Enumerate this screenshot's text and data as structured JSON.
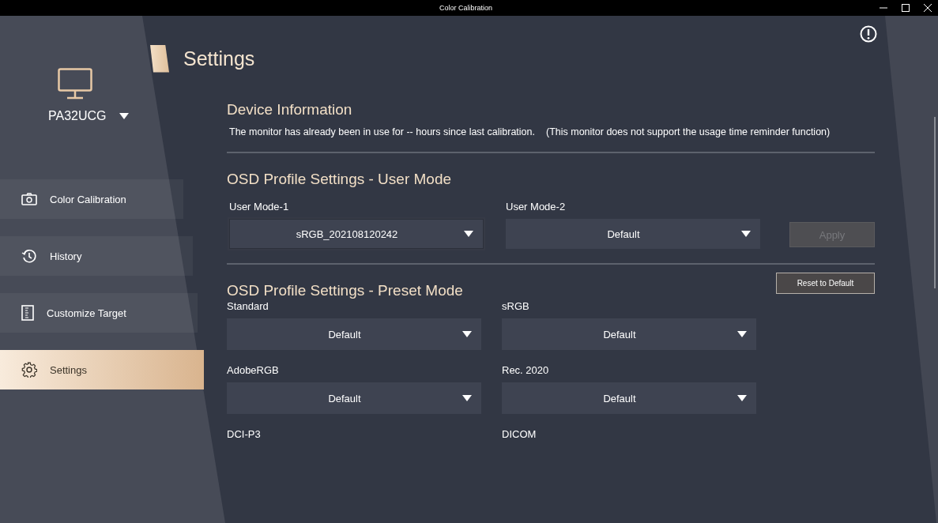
{
  "window": {
    "title": "Color Calibration"
  },
  "sidebar": {
    "device": "PA32UCG",
    "items": [
      {
        "label": "Color Calibration",
        "kind": "calibration",
        "selected": false
      },
      {
        "label": "History",
        "kind": "history",
        "selected": false
      },
      {
        "label": "Customize Target",
        "kind": "target",
        "selected": false
      },
      {
        "label": "Settings",
        "kind": "settings",
        "selected": true
      }
    ]
  },
  "page_title": "Settings",
  "device_information": {
    "heading": "Device Information",
    "usage_text": "The monitor has already been in use for -- hours since last calibration.",
    "note": "(This monitor does not support the usage time reminder function)"
  },
  "user_mode": {
    "heading": "OSD Profile Settings - User Mode",
    "fields": [
      {
        "label": "User Mode-1",
        "value": "sRGB_202108120242",
        "focused": true
      },
      {
        "label": "User Mode-2",
        "value": "Default",
        "focused": false
      }
    ],
    "apply_button": {
      "label": "Apply",
      "disabled": true
    }
  },
  "preset_mode": {
    "heading": "OSD Profile Settings - Preset Mode",
    "reset_button": "Reset to Default",
    "fields": [
      {
        "label": "Standard",
        "value": "Default"
      },
      {
        "label": "sRGB",
        "value": "Default"
      },
      {
        "label": "AdobeRGB",
        "value": "Default"
      },
      {
        "label": "Rec. 2020",
        "value": "Default"
      },
      {
        "label": "DCI-P3"
      },
      {
        "label": "DICOM"
      }
    ]
  }
}
